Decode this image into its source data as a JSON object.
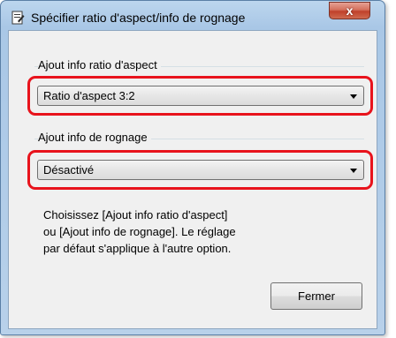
{
  "window": {
    "title": "Spécifier ratio d'aspect/info de rognage",
    "close_glyph": "x"
  },
  "aspect_group": {
    "label": "Ajout info ratio d'aspect",
    "selected_value": "Ratio d'aspect 3:2"
  },
  "crop_group": {
    "label": "Ajout info de rognage",
    "selected_value": "Désactivé"
  },
  "description": {
    "line1": "Choisissez [Ajout info ratio d'aspect]",
    "line2": "ou [Ajout info de rognage]. Le réglage",
    "line3": "par défaut s'applique à l'autre option."
  },
  "buttons": {
    "close_label": "Fermer"
  },
  "colors": {
    "highlight": "#e8131c",
    "close_button": "#c0402a"
  },
  "icons": {
    "app": "document-edit-icon",
    "dropdown": "chevron-down-icon"
  }
}
